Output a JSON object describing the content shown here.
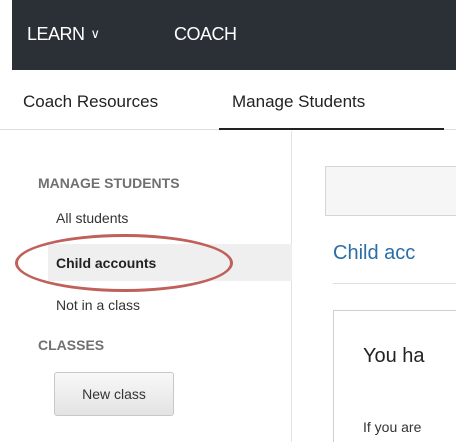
{
  "topnav": {
    "learn_label": "LEARN",
    "learn_chevron": "∨",
    "coach_label": "COACH"
  },
  "subnav": {
    "tabs": [
      {
        "label": "Coach Resources"
      },
      {
        "label": "Manage Students"
      }
    ],
    "active_tab": "Manage Students"
  },
  "sidebar": {
    "manage_heading": "MANAGE STUDENTS",
    "items": [
      {
        "label": "All students"
      },
      {
        "label": "Child accounts"
      },
      {
        "label": "Not in a class"
      }
    ],
    "selected_item": "Child accounts",
    "classes_heading": "CLASSES",
    "new_class_button": "New class"
  },
  "main": {
    "title": "Child acc",
    "box_heading": "You ha",
    "box_text": "If you are"
  },
  "colors": {
    "topbar_bg": "#2b3036",
    "link_blue": "#2a6ea7",
    "annotation_circle": "#c0605a"
  }
}
